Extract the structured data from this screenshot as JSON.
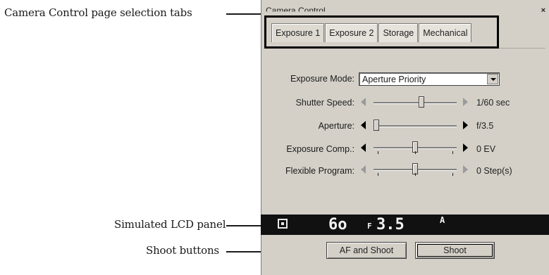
{
  "callouts": {
    "tabs": "Camera Control page selection tabs",
    "lcd": "Simulated LCD panel",
    "shoot": "Shoot buttons"
  },
  "window": {
    "title": "Camera Control",
    "close": "×"
  },
  "tabs": [
    {
      "label": "Exposure 1",
      "active": true
    },
    {
      "label": "Exposure 2",
      "active": false
    },
    {
      "label": "Storage",
      "active": false
    },
    {
      "label": "Mechanical",
      "active": false
    }
  ],
  "controls": {
    "exposure_mode": {
      "label": "Exposure Mode:",
      "value": "Aperture Priority"
    },
    "shutter_speed": {
      "label": "Shutter Speed:",
      "value": "1/60 sec",
      "enabled": false,
      "level": 0.58
    },
    "aperture": {
      "label": "Aperture:",
      "value": "f/3.5",
      "enabled": true,
      "level": 0.0
    },
    "exposure_comp": {
      "label": "Exposure Comp.:",
      "value": "0 EV",
      "enabled": true,
      "level": 0.5
    },
    "flexible_program": {
      "label": "Flexible Program:",
      "value": "0 Step(s)",
      "enabled": false,
      "level": 0.5
    }
  },
  "lcd": {
    "shutter": "6o",
    "aperture_prefix": "F",
    "aperture": "3.5",
    "mode": "A"
  },
  "buttons": {
    "af_shoot": "AF and Shoot",
    "shoot": "Shoot"
  }
}
